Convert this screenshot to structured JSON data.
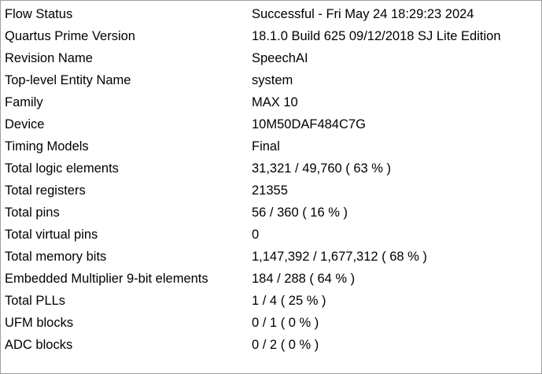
{
  "flow_summary": {
    "rows": [
      {
        "label": "Flow Status",
        "value": "Successful - Fri May 24 18:29:23 2024"
      },
      {
        "label": "Quartus Prime Version",
        "value": "18.1.0 Build 625 09/12/2018 SJ Lite Edition"
      },
      {
        "label": "Revision Name",
        "value": "SpeechAI"
      },
      {
        "label": "Top-level Entity Name",
        "value": "system"
      },
      {
        "label": "Family",
        "value": "MAX 10"
      },
      {
        "label": "Device",
        "value": "10M50DAF484C7G"
      },
      {
        "label": "Timing Models",
        "value": "Final"
      },
      {
        "label": "Total logic elements",
        "value": "31,321 / 49,760 ( 63 % )"
      },
      {
        "label": "Total registers",
        "value": "21355"
      },
      {
        "label": "Total pins",
        "value": "56 / 360 ( 16 % )"
      },
      {
        "label": "Total virtual pins",
        "value": "0"
      },
      {
        "label": "Total memory bits",
        "value": "1,147,392 / 1,677,312 ( 68 % )"
      },
      {
        "label": "Embedded Multiplier 9-bit elements",
        "value": "184 / 288 ( 64 % )"
      },
      {
        "label": "Total PLLs",
        "value": "1 / 4 ( 25 % )"
      },
      {
        "label": "UFM blocks",
        "value": "0 / 1 ( 0 % )"
      },
      {
        "label": "ADC blocks",
        "value": "0 / 2 ( 0 % )"
      }
    ]
  }
}
